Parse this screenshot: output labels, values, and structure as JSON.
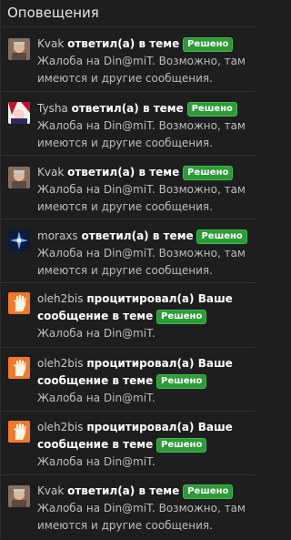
{
  "header": {
    "title": "Оповещения"
  },
  "badge_label": "Решено",
  "items": [
    {
      "user": "Kvak",
      "action": "ответил(а) в теме",
      "thread": "Жалоба на Din@miT. Возможно, там имеются и другие сообщения.",
      "avatar": "old-man-avatar"
    },
    {
      "user": "Tysha",
      "action": "ответил(а) в теме",
      "thread": "Жалоба на Din@miT. Возможно, там имеются и другие сообщения.",
      "avatar": "anime-avatar"
    },
    {
      "user": "Kvak",
      "action": "ответил(а) в теме",
      "thread": "Жалоба на Din@miT. Возможно, там имеются и другие сообщения.",
      "avatar": "old-man-avatar"
    },
    {
      "user": "moraxs",
      "action": "ответил(а) в теме",
      "thread": "Жалоба на Din@miT. Возможно, там имеются и другие сообщения.",
      "avatar": "blue-spark-avatar"
    },
    {
      "user": "oleh2bis",
      "action": "процитировал(а) Ваше сообщение в теме",
      "thread": "Жалоба на Din@miT.",
      "avatar": "raised-hand-avatar"
    },
    {
      "user": "oleh2bis",
      "action": "процитировал(а) Ваше сообщение в теме",
      "thread": "Жалоба на Din@miT.",
      "avatar": "raised-hand-avatar"
    },
    {
      "user": "oleh2bis",
      "action": "процитировал(а) Ваше сообщение в теме",
      "thread": "Жалоба на Din@miT.",
      "avatar": "raised-hand-avatar"
    },
    {
      "user": "Kvak",
      "action": "ответил(а) в теме",
      "thread": "Жалоба на Din@miT. Возможно, там имеются и другие сообщения.",
      "avatar": "old-man-avatar"
    }
  ]
}
